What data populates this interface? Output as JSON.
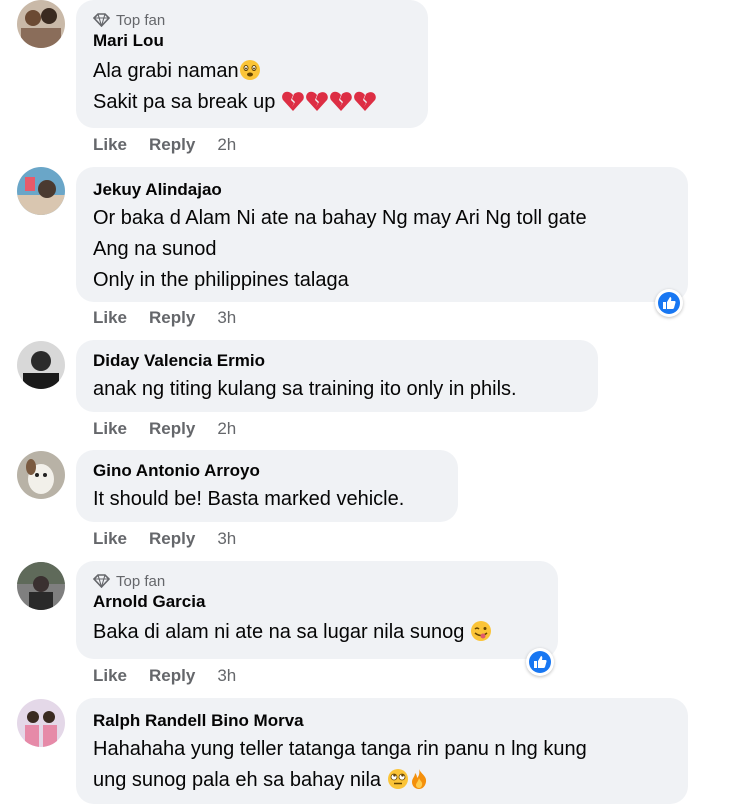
{
  "comments": [
    {
      "badge": "Top fan",
      "name": "Mari Lou",
      "lines": [
        "Ala grabi naman",
        "Sakit pa sa break up"
      ],
      "like": "Like",
      "reply": "Reply",
      "time": "2h"
    },
    {
      "name": "Jekuy Alindajao",
      "lines": [
        "Or baka d Alam Ni ate na bahay Ng may Ari Ng toll gate",
        "Ang na sunod",
        "Only in the philippines talaga"
      ],
      "like": "Like",
      "reply": "Reply",
      "time": "3h"
    },
    {
      "name": "Diday Valencia Ermio",
      "lines": [
        "anak ng titing kulang sa training ito only in phils."
      ],
      "like": "Like",
      "reply": "Reply",
      "time": "2h"
    },
    {
      "name": "Gino Antonio Arroyo",
      "lines": [
        "It should be! Basta marked vehicle."
      ],
      "like": "Like",
      "reply": "Reply",
      "time": "3h"
    },
    {
      "badge": "Top fan",
      "name": "Arnold Garcia",
      "lines": [
        "Baka di alam ni ate na sa lugar nila sunog"
      ],
      "like": "Like",
      "reply": "Reply",
      "time": "3h"
    },
    {
      "name": "Ralph Randell Bino Morva",
      "lines": [
        "Hahahaha yung teller tatanga tanga rin panu n lng kung",
        "ung sunog pala eh sa bahay nila"
      ]
    }
  ],
  "colors": {
    "bubble": "#f0f2f5",
    "meta": "#65676b",
    "like_blue": "#1877f2"
  }
}
